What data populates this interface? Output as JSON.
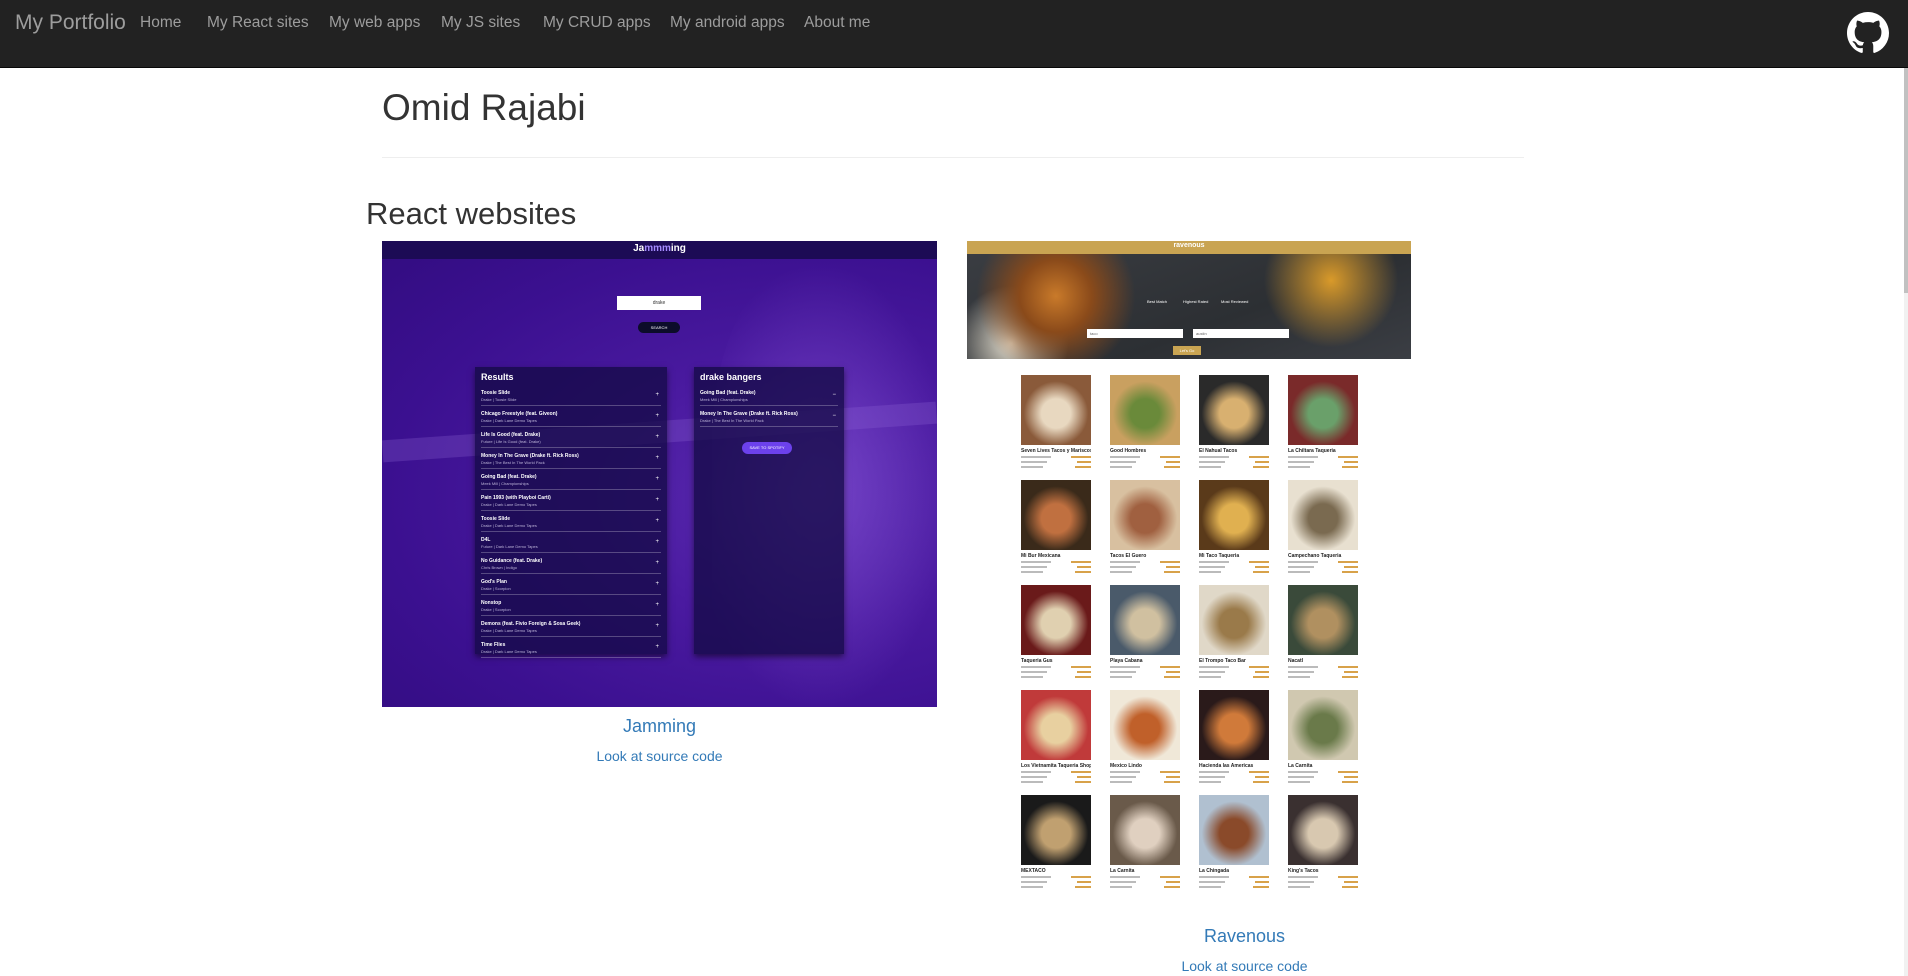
{
  "navbar": {
    "brand": "My Portfolio",
    "items": [
      "Home",
      "My React sites",
      "My web apps",
      "My JS sites",
      "My CRUD apps",
      "My android apps",
      "About me"
    ],
    "github_icon": "github-icon"
  },
  "header": {
    "name": "Omid Rajabi"
  },
  "section": {
    "title": "React websites"
  },
  "projects": [
    {
      "title": "Jamming",
      "link": "Look at source code",
      "screenshot": {
        "logo": "Jammming",
        "search_value": "drake",
        "search_button": "SEARCH",
        "results_title": "Results",
        "results": [
          {
            "name": "Toosie Slide",
            "album": "Drake | Toosie Slide"
          },
          {
            "name": "Chicago Freestyle (feat. Giveon)",
            "album": "Drake | Dark Lane Demo Tapes"
          },
          {
            "name": "Life Is Good (feat. Drake)",
            "album": "Future | Life Is Good (feat. Drake)"
          },
          {
            "name": "Money In The Grave (Drake ft. Rick Ross)",
            "album": "Drake | The Best In The World Pack"
          },
          {
            "name": "Going Bad (feat. Drake)",
            "album": "Meek Mill | Championships"
          },
          {
            "name": "Pain 1993 (with Playboi Carti)",
            "album": "Drake | Dark Lane Demo Tapes"
          },
          {
            "name": "Toosie Slide",
            "album": "Drake | Dark Lane Demo Tapes"
          },
          {
            "name": "D4L",
            "album": "Future | Dark Lane Demo Tapes"
          },
          {
            "name": "No Guidance (feat. Drake)",
            "album": "Chris Brown | Indigo"
          },
          {
            "name": "God's Plan",
            "album": "Drake | Scorpion"
          },
          {
            "name": "Nonstop",
            "album": "Drake | Scorpion"
          },
          {
            "name": "Demons (feat. Fivio Foreign & Sosa Geek)",
            "album": "Drake | Dark Lane Demo Tapes"
          },
          {
            "name": "Time Flies",
            "album": "Drake | Dark Lane Demo Tapes"
          }
        ],
        "playlist_title": "drake bangers",
        "playlist": [
          {
            "name": "Going Bad (feat. Drake)",
            "album": "Meek Mill | Championships"
          },
          {
            "name": "Money In The Grave (Drake ft. Rick Ross)",
            "album": "Drake | The Best In The World Pack"
          }
        ],
        "save_button": "SAVE TO SPOTIFY"
      }
    },
    {
      "title": "Ravenous",
      "link": "Look at source code",
      "screenshot": {
        "logo": "ravenous",
        "sort_options": [
          "Best Match",
          "Highest Rated",
          "Most Reviewed"
        ],
        "term_value": "taco",
        "location_value": "austin",
        "go_button": "Let's Go",
        "businesses": [
          "Seven Lives Tacos y Mariscos",
          "Good Hombres",
          "El Nahual Tacos",
          "La Chiltara Taqueria",
          "Mi Bur Mexicana",
          "Tacos El Guero",
          "Mi Taco Taqueria",
          "Campechano Taqueria",
          "Taqueria Gus",
          "Playa Cabana",
          "El Trompo Taco Bar",
          "Nacatl",
          "Los Vietnamita Taqueria Shop",
          "Mexico Lindo",
          "Hacienda las Americas",
          "La Carnita",
          "MEXTACO",
          "La Carnita",
          "La Chingada",
          "King's Tacos"
        ]
      }
    }
  ],
  "colors": {
    "navbar": "#222222",
    "nav_text": "#9d9d9d",
    "link": "#337ab7",
    "heading": "#333333"
  }
}
